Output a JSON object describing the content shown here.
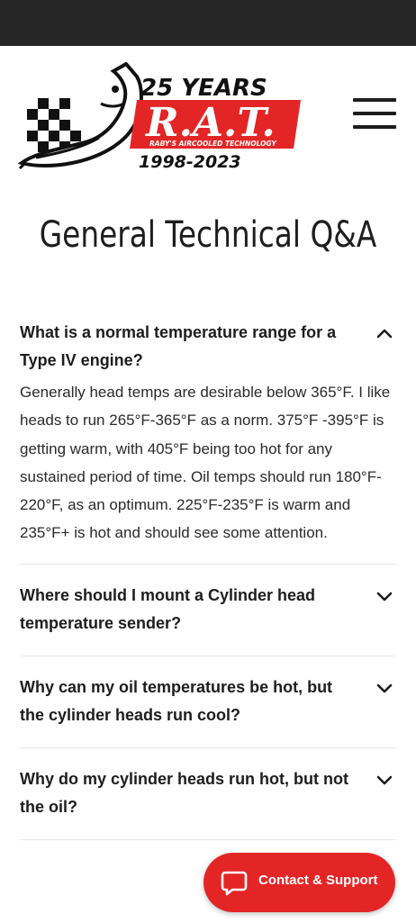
{
  "logo": {
    "years_text": "25 YEARS",
    "brand_text": "R.A.T.",
    "tagline": "RABY'S AIRCOOLED TECHNOLOGY",
    "dates": "1998-2023"
  },
  "header": {
    "menu_icon": "hamburger-menu-icon"
  },
  "page": {
    "title": "General Technical Q&A"
  },
  "faq": {
    "items": [
      {
        "question": "What is a normal temperature range for a Type IV engine?",
        "answer": "Generally head temps are desirable below 365°F. I like heads to run 265°F-365°F as a norm. 375°F -395°F is getting warm, with 405°F being too hot for any sustained period of time. Oil temps should run 180°F-220°F, as an optimum. 225°F-235°F is warm and 235°F+ is hot and should see some attention.",
        "expanded": true,
        "icon": "chevron-up-icon"
      },
      {
        "question": "Where should I mount a Cylinder head temperature sender?",
        "expanded": false,
        "icon": "chevron-down-icon"
      },
      {
        "question": "Why can my oil temperatures be hot, but the cylinder heads run cool?",
        "expanded": false,
        "icon": "chevron-down-icon"
      },
      {
        "question": "Why do my cylinder heads run hot, but not the oil?",
        "expanded": false,
        "icon": "chevron-down-icon"
      }
    ]
  },
  "contact": {
    "label": "Contact & Support",
    "icon": "chat-bubble-icon"
  },
  "colors": {
    "accent_red": "#e32526",
    "status_bar": "#262626",
    "text": "#1d1d1d",
    "divider": "#e7e7e7"
  }
}
